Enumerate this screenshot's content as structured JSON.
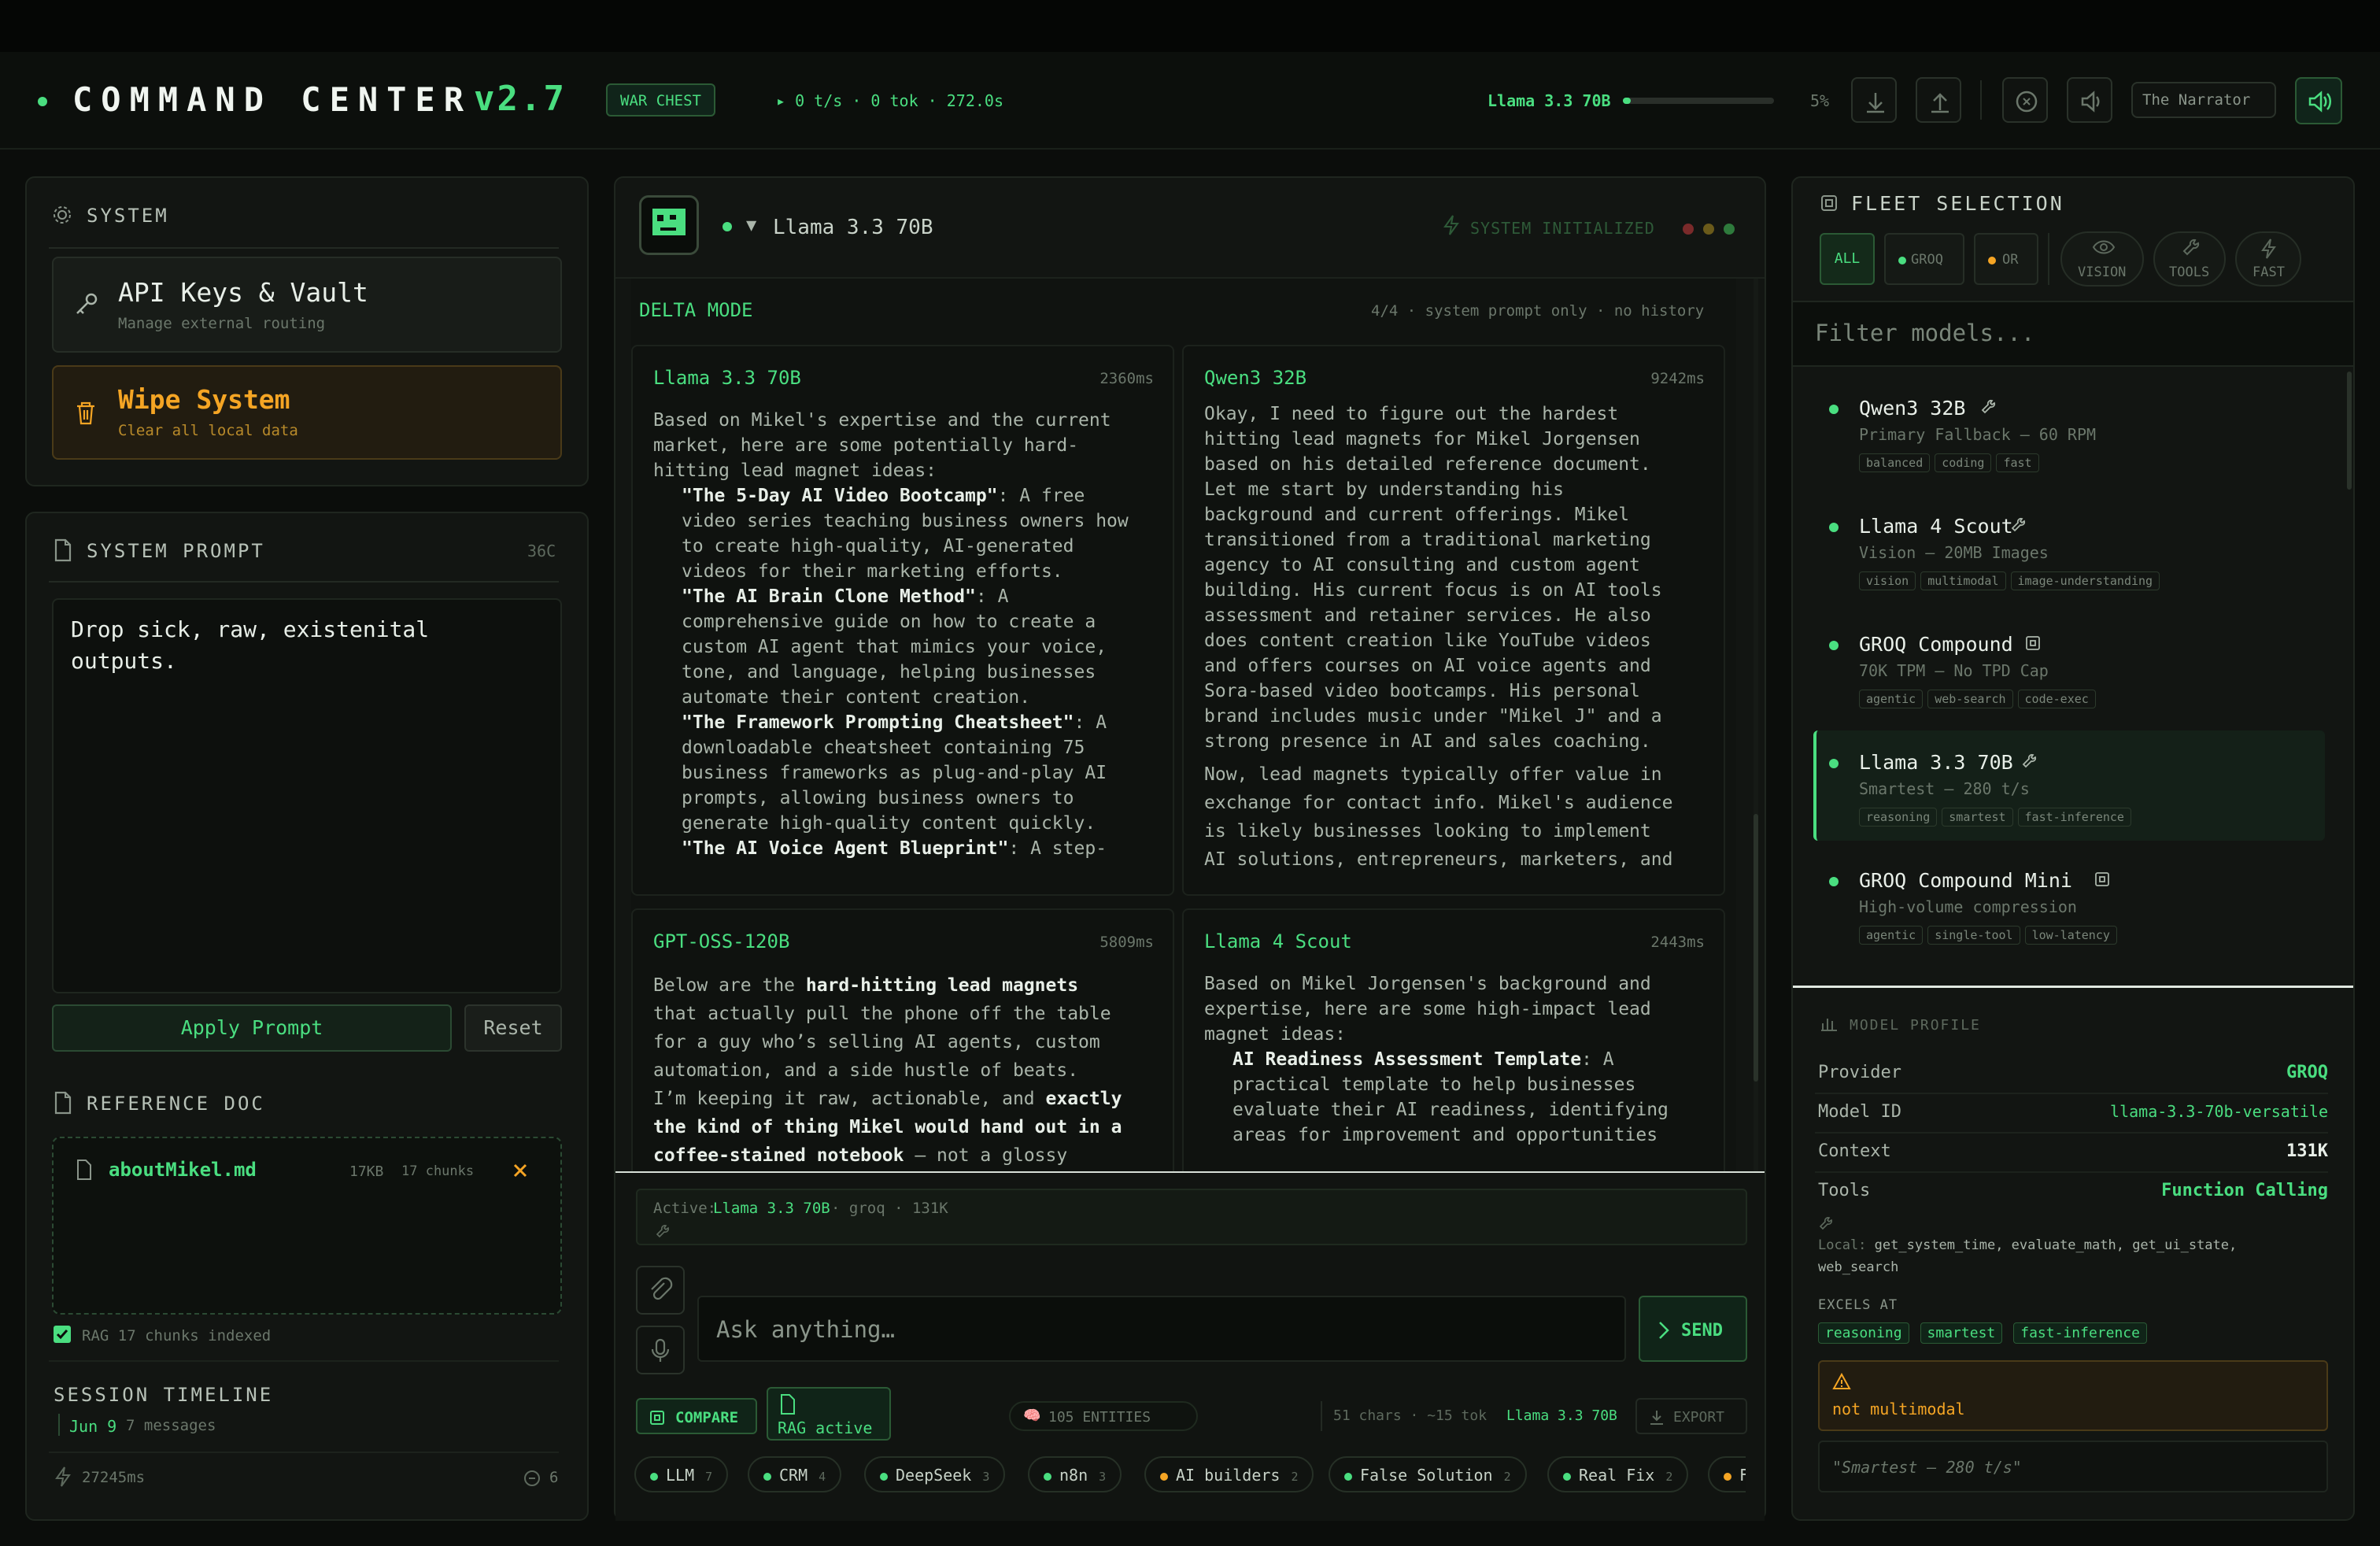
{
  "header": {
    "title": "COMMAND CENTER",
    "version": "v2.7",
    "badge": "WAR CHEST",
    "stats": "▸ 0 t/s · 0 tok · 272.0s",
    "model": "Llama 3.3 70B",
    "progress_pct": "5%",
    "progress_value": 0.05,
    "narrator": "The Narrator"
  },
  "system": {
    "title": "SYSTEM",
    "api_title": "API Keys & Vault",
    "api_sub": "Manage external routing",
    "wipe_title": "Wipe System",
    "wipe_sub": "Clear all local data"
  },
  "prompt": {
    "title": "SYSTEM PROMPT",
    "count": "36C",
    "text": "Drop sick, raw, existenital outputs.",
    "apply": "Apply Prompt",
    "reset": "Reset"
  },
  "refdoc": {
    "title": "REFERENCE DOC",
    "file": "aboutMikel.md",
    "size": "17KB",
    "chunks": "17 chunks",
    "rag": "RAG 17 chunks indexed"
  },
  "timeline": {
    "title": "SESSION TIMELINE",
    "date": "Jun 9",
    "messages": "7 messages",
    "time": "27245ms",
    "count": "6"
  },
  "chat": {
    "model": "Llama 3.3 70B",
    "status": "SYSTEM INITIALIZED",
    "mode": "DELTA MODE",
    "mode_info": "4/4 · system prompt only · no history",
    "cards": [
      {
        "name": "Llama 3.3 70B",
        "ms": "2360ms",
        "body": "Based on Mikel's expertise and the current\nmarket, here are some potentially hard-\nhitting lead magnet ideas:",
        "items": [
          {
            "title": "\"The 5-Day AI Video Bootcamp\"",
            "text": ": A free\nvideo series teaching business owners how\nto create high-quality, AI-generated\nvideos for their marketing efforts."
          },
          {
            "title": "\"The AI Brain Clone Method\"",
            "text": ": A\ncomprehensive guide on how to create a\ncustom AI agent that mimics your voice,\ntone, and language, helping businesses\nautomate their content creation."
          },
          {
            "title": "\"The Framework Prompting Cheatsheet\"",
            "text": ": A\ndownloadable cheatsheet containing 75\nbusiness frameworks as plug-and-play AI\nprompts, allowing business owners to\ngenerate high-quality content quickly."
          },
          {
            "title": "\"The AI Voice Agent Blueprint\"",
            "text": ": A step-"
          }
        ]
      },
      {
        "name": "Qwen3 32B",
        "ms": "9242ms",
        "body": "Okay, I need to figure out the hardest\nhitting lead magnets for Mikel Jorgensen\nbased on his detailed reference document.\nLet me start by understanding his\nbackground and current offerings. Mikel\ntransitioned from a traditional marketing\nagency to AI consulting and custom agent\nbuilding. His current focus is on AI tools\nassessment and retainer services. He also\ndoes content creation like YouTube videos\nand offers courses on AI voice agents and\nSora-based video bootcamps. His personal\nbrand includes music under \"Mikel J\" and a\nstrong presence in AI and sales coaching.",
        "body2": "Now, lead magnets typically offer value in\nexchange for contact info. Mikel's audience\nis likely businesses looking to implement\nAI solutions, entrepreneurs, marketers, and"
      },
      {
        "name": "GPT-OSS-120B",
        "ms": "5809ms",
        "p1": "Below are the ",
        "p1b": "hard-hitting lead magnets",
        "p2": "\nthat actually pull the phone off the table\nfor a guy who’s selling AI agents, custom\nautomation, and a side hustle of beats.\nI’m keeping it raw, actionable, and ",
        "p2b": "exactly\nthe kind of thing Mikel would hand out in a\ncoffee-stained notebook",
        "p3": " – not a glossy"
      },
      {
        "name": "Llama 4 Scout",
        "ms": "2443ms",
        "body": "Based on Mikel Jorgensen's background and\nexpertise, here are some high-impact lead\nmagnet ideas:",
        "item_title": "AI Readiness Assessment Template",
        "item_text": ": A\npractical template to help businesses\nevaluate their AI readiness, identifying\nareas for improvement and opportunities"
      }
    ],
    "active_label": "Active:",
    "active_model": "Llama 3.3 70B",
    "active_meta": "· groq · 131K",
    "placeholder": "Ask anything…",
    "send": "SEND",
    "compare": "COMPARE",
    "rag_active": "RAG active",
    "entities": "105 ENTITIES",
    "meta": "51 chars · ~15 tok",
    "meta_model": "Llama 3.3 70B",
    "export": "EXPORT",
    "chips": [
      {
        "label": "LLM",
        "count": "7",
        "color": "#4ade80"
      },
      {
        "label": "CRM",
        "count": "4",
        "color": "#4ade80"
      },
      {
        "label": "DeepSeek",
        "count": "3",
        "color": "#4ade80"
      },
      {
        "label": "n8n",
        "count": "3",
        "color": "#4ade80"
      },
      {
        "label": "AI builders",
        "count": "2",
        "color": "#f5a524"
      },
      {
        "label": "False Solution",
        "count": "2",
        "color": "#4ade80"
      },
      {
        "label": "Real Fix",
        "count": "2",
        "color": "#4ade80"
      },
      {
        "label": "F",
        "count": "",
        "color": "#f5a524"
      }
    ]
  },
  "fleet": {
    "title": "FLEET SELECTION",
    "filters": {
      "all": "ALL",
      "groq": "GROQ",
      "or": "OR",
      "vision": "VISION",
      "tools": "TOOLS",
      "fast": "FAST"
    },
    "filter_placeholder": "Filter models...",
    "models": [
      {
        "name": "Qwen3 32B",
        "sub": "Primary Fallback — 60 RPM",
        "tags": [
          "balanced",
          "coding",
          "fast"
        ],
        "icon": "wrench-icon"
      },
      {
        "name": "Llama 4 Scout",
        "sub": "Vision — 20MB Images",
        "tags": [
          "vision",
          "multimodal",
          "image-understanding"
        ],
        "icon": "wrench-icon"
      },
      {
        "name": "GROQ Compound",
        "sub": "70K TPM — No TPD Cap",
        "tags": [
          "agentic",
          "web-search",
          "code-exec"
        ],
        "icon": "chip-icon"
      },
      {
        "name": "Llama 3.3 70B",
        "sub": "Smartest — 280 t/s",
        "tags": [
          "reasoning",
          "smartest",
          "fast-inference"
        ],
        "icon": "wrench-icon"
      },
      {
        "name": "GROQ Compound Mini",
        "sub": "High-volume compression",
        "tags": [
          "agentic",
          "single-tool",
          "low-latency"
        ],
        "icon": "chip-icon"
      }
    ]
  },
  "profile": {
    "title": "MODEL PROFILE",
    "provider_label": "Provider",
    "provider": "GROQ",
    "id_label": "Model ID",
    "id": "llama-3.3-70b-versatile",
    "context_label": "Context",
    "context": "131K",
    "tools_label": "Tools",
    "tools": "Function Calling",
    "local_label": "Local:",
    "local": "get_system_time, evaluate_math, get_ui_state,\nweb_search",
    "excels": "EXCELS AT",
    "excel_tags": [
      "reasoning",
      "smartest",
      "fast-inference"
    ],
    "warning": "not multimodal",
    "quote": "\"Smartest — 280 t/s\""
  },
  "colors": {
    "accent": "#4ade80",
    "warning": "#f5a524",
    "bg": "#0b0d0b"
  }
}
